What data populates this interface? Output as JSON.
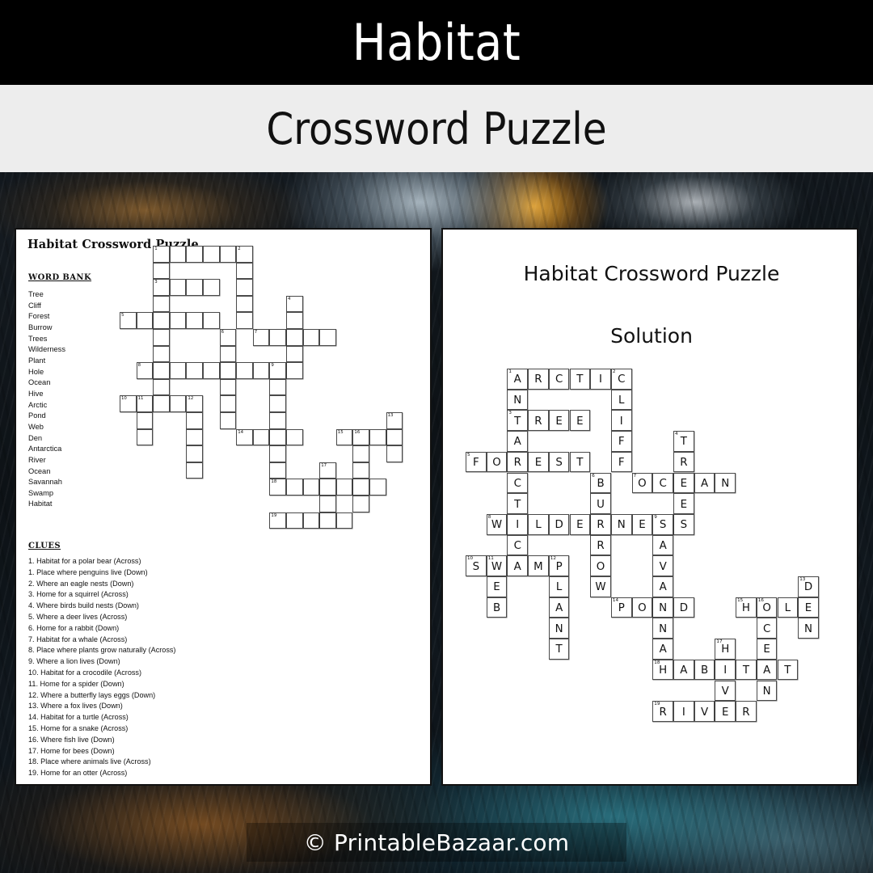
{
  "header": {
    "title": "Habitat",
    "subtitle": "Crossword Puzzle"
  },
  "footer": {
    "copyright": "© PrintableBazaar.com"
  },
  "puzzle_page": {
    "heading": "Habitat Crossword Puzzle",
    "word_bank_label": "WORD BANK",
    "word_bank": [
      "Tree",
      "Cliff",
      "Forest",
      "Burrow",
      "Trees",
      "Wilderness",
      "Plant",
      "Hole",
      "Ocean",
      "Hive",
      "Arctic",
      "Pond",
      "Web",
      "Den",
      "Antarctica",
      "River",
      "Ocean",
      "Savannah",
      "Swamp",
      "Habitat"
    ],
    "clues_label": "CLUES",
    "clues": [
      "1. Habitat for a polar bear (Across)",
      "1. Place where penguins live (Down)",
      "2. Where an eagle nests (Down)",
      "3. Home for a squirrel (Across)",
      "4. Where birds build nests (Down)",
      "5. Where a deer lives (Across)",
      "6. Home for a rabbit (Down)",
      "7. Habitat for a whale (Across)",
      "8. Place where plants grow naturally (Across)",
      "9. Where a lion lives (Down)",
      "10. Habitat for a crocodile (Across)",
      "11. Home for a spider (Down)",
      "12. Where a butterfly lays eggs (Down)",
      "13. Where a fox lives (Down)",
      "14. Habitat for a turtle (Across)",
      "15. Home for a snake (Across)",
      "16. Where fish live (Down)",
      "17. Home for bees (Down)",
      "18. Place where animals live (Across)",
      "19. Home for an otter (Across)"
    ]
  },
  "solution_page": {
    "heading": "Habitat Crossword Puzzle",
    "subheading": "Solution"
  },
  "crossword": {
    "cell_size_puzzle": 20.6,
    "cell_size_solution": 25.7,
    "columns": 18,
    "rows": 16,
    "entries": [
      {
        "number": 1,
        "direction": "across",
        "answer": "ARCTIC",
        "clue": "Habitat for a polar bear",
        "row": 0,
        "col": 2
      },
      {
        "number": 1,
        "direction": "down",
        "answer": "ANTARCTICA",
        "clue": "Place where penguins live",
        "row": 0,
        "col": 2
      },
      {
        "number": 2,
        "direction": "down",
        "answer": "CLIFF",
        "clue": "Where an eagle nests",
        "row": 0,
        "col": 7
      },
      {
        "number": 3,
        "direction": "across",
        "answer": "TREE",
        "clue": "Home for a squirrel",
        "row": 2,
        "col": 2
      },
      {
        "number": 4,
        "direction": "down",
        "answer": "TREES",
        "clue": "Where birds build nests",
        "row": 3,
        "col": 10
      },
      {
        "number": 5,
        "direction": "across",
        "answer": "FOREST",
        "clue": "Where a deer lives",
        "row": 4,
        "col": 0
      },
      {
        "number": 6,
        "direction": "down",
        "answer": "BURROW",
        "clue": "Home for a rabbit",
        "row": 5,
        "col": 6
      },
      {
        "number": 7,
        "direction": "across",
        "answer": "OCEAN",
        "clue": "Habitat for a whale",
        "row": 5,
        "col": 8
      },
      {
        "number": 8,
        "direction": "across",
        "answer": "WILDERNESS",
        "clue": "Place where plants grow naturally",
        "row": 7,
        "col": 1
      },
      {
        "number": 9,
        "direction": "down",
        "answer": "SAVANNAH",
        "clue": "Where a lion lives",
        "row": 7,
        "col": 9
      },
      {
        "number": 10,
        "direction": "across",
        "answer": "SWAMP",
        "clue": "Habitat for a crocodile",
        "row": 9,
        "col": 0
      },
      {
        "number": 11,
        "direction": "down",
        "answer": "WEB",
        "clue": "Home for a spider",
        "row": 9,
        "col": 1
      },
      {
        "number": 12,
        "direction": "down",
        "answer": "PLANT",
        "clue": "Where a butterfly lays eggs",
        "row": 9,
        "col": 4
      },
      {
        "number": 13,
        "direction": "down",
        "answer": "DEN",
        "clue": "Where a fox lives",
        "row": 10,
        "col": 16
      },
      {
        "number": 14,
        "direction": "across",
        "answer": "POND",
        "clue": "Habitat for a turtle",
        "row": 11,
        "col": 7
      },
      {
        "number": 15,
        "direction": "across",
        "answer": "HOLE",
        "clue": "Home for a snake",
        "row": 11,
        "col": 13
      },
      {
        "number": 16,
        "direction": "down",
        "answer": "OCEAN",
        "clue": "Where fish live",
        "row": 11,
        "col": 14
      },
      {
        "number": 17,
        "direction": "down",
        "answer": "HIVE",
        "clue": "Home for bees",
        "row": 13,
        "col": 12
      },
      {
        "number": 18,
        "direction": "across",
        "answer": "HABITAT",
        "clue": "Place where animals live",
        "row": 14,
        "col": 9
      },
      {
        "number": 19,
        "direction": "across",
        "answer": "RIVER",
        "clue": "Home for an otter",
        "row": 16,
        "col": 9
      }
    ]
  },
  "colors": {
    "banner_bg": "#000000",
    "subtitle_bg": "#ededed",
    "sheet_bg": "#ffffff",
    "ink": "#111111",
    "cell_border": "#4a4a4a"
  }
}
